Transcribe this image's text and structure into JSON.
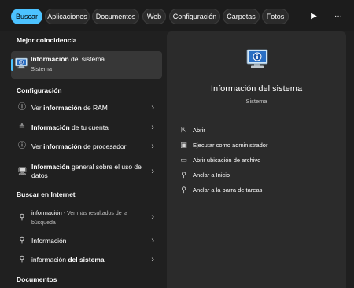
{
  "tabs": [
    {
      "label": "Buscar",
      "active": true
    },
    {
      "label": "Aplicaciones",
      "active": false
    },
    {
      "label": "Documentos",
      "active": false
    },
    {
      "label": "Web",
      "active": false
    },
    {
      "label": "Configuración",
      "active": false
    },
    {
      "label": "Carpetas",
      "active": false
    },
    {
      "label": "Fotos",
      "active": false
    }
  ],
  "toolbar": {
    "play_icon": "play-icon",
    "more_icon": "more-icon",
    "more_text": "···"
  },
  "sections": {
    "best": "Mejor coincidencia",
    "config": "Configuración",
    "internet": "Buscar en Internet",
    "documents": "Documentos"
  },
  "best_match": {
    "title_bold": "Información",
    "title_rest": " del sistema",
    "subtitle": "Sistema"
  },
  "config_items": [
    {
      "pre": "Ver ",
      "bold": "información",
      "post": " de RAM",
      "icon": "info-icon"
    },
    {
      "pre": "",
      "bold": "Información",
      "post": " de tu cuenta",
      "icon": "account-list-icon"
    },
    {
      "pre": "Ver ",
      "bold": "información",
      "post": " de procesador",
      "icon": "info-icon"
    },
    {
      "pre": "",
      "bold": "Información",
      "post": " general sobre el uso de datos",
      "icon": "computer-icon"
    }
  ],
  "internet_items": [
    {
      "text": "información",
      "muted": " - Ver más resultados de la búsqueda"
    },
    {
      "text": "Información"
    },
    {
      "pre": "información ",
      "bold": "del sistema"
    }
  ],
  "preview": {
    "name": "Información del sistema",
    "type": "Sistema"
  },
  "actions": [
    {
      "label": "Abrir",
      "icon": "open-icon"
    },
    {
      "label": "Ejecutar como administrador",
      "icon": "admin-shield-icon"
    },
    {
      "label": "Abrir ubicación de archivo",
      "icon": "folder-icon"
    },
    {
      "label": "Anclar a Inicio",
      "icon": "pin-icon"
    },
    {
      "label": "Anclar a la barra de tareas",
      "icon": "pin-icon"
    }
  ],
  "colors": {
    "accent": "#4cc2ff",
    "background": "#202020",
    "pane": "#2b2b2b"
  }
}
